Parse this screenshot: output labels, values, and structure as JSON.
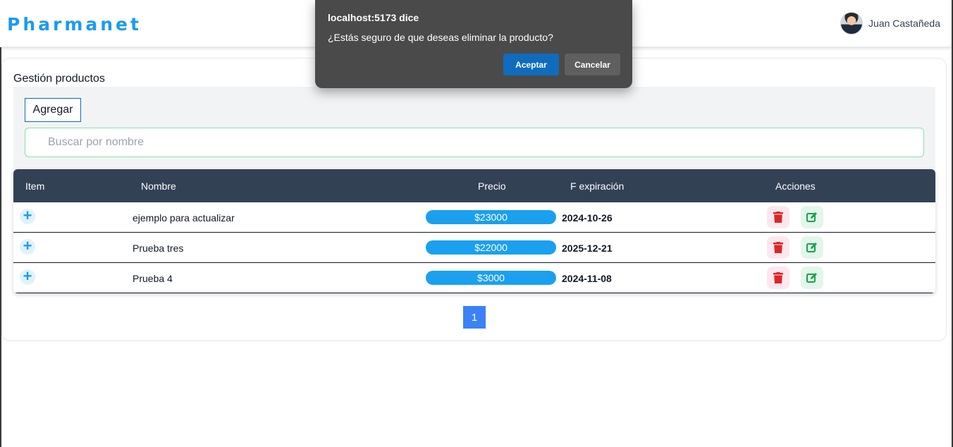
{
  "navbar": {
    "brand": "Pharmanet",
    "user_name": "Juan Castañeda"
  },
  "card": {
    "title": "Gestión productos",
    "add_label": "Agregar",
    "search_placeholder": "Buscar por nombre"
  },
  "table": {
    "headers": {
      "item": "Item",
      "nombre": "Nombre",
      "precio": "Precio",
      "expiracion": "F expiración",
      "acciones": "Acciones"
    },
    "rows": [
      {
        "nombre": "ejemplo para actualizar",
        "precio": "$23000",
        "fecha": "2024-10-26"
      },
      {
        "nombre": "Prueba tres",
        "precio": "$22000",
        "fecha": "2025-12-21"
      },
      {
        "nombre": "Prueba 4",
        "precio": "$3000",
        "fecha": "2024-11-08"
      }
    ],
    "icons": {
      "expand": "plus-icon",
      "delete": "trash-icon",
      "edit": "edit-icon"
    }
  },
  "pagination": {
    "current_page": "1"
  },
  "dialog": {
    "title": "localhost:5173 dice",
    "message": "¿Estás seguro de que deseas eliminar la producto?",
    "accept_label": "Aceptar",
    "cancel_label": "Cancelar"
  },
  "colors": {
    "brand": "#1a9cf0",
    "header_bg": "#334155",
    "price_pill": "#1aa0ef",
    "delete": "#dc2626",
    "edit": "#16a34a",
    "accept": "#0f6cbd"
  }
}
